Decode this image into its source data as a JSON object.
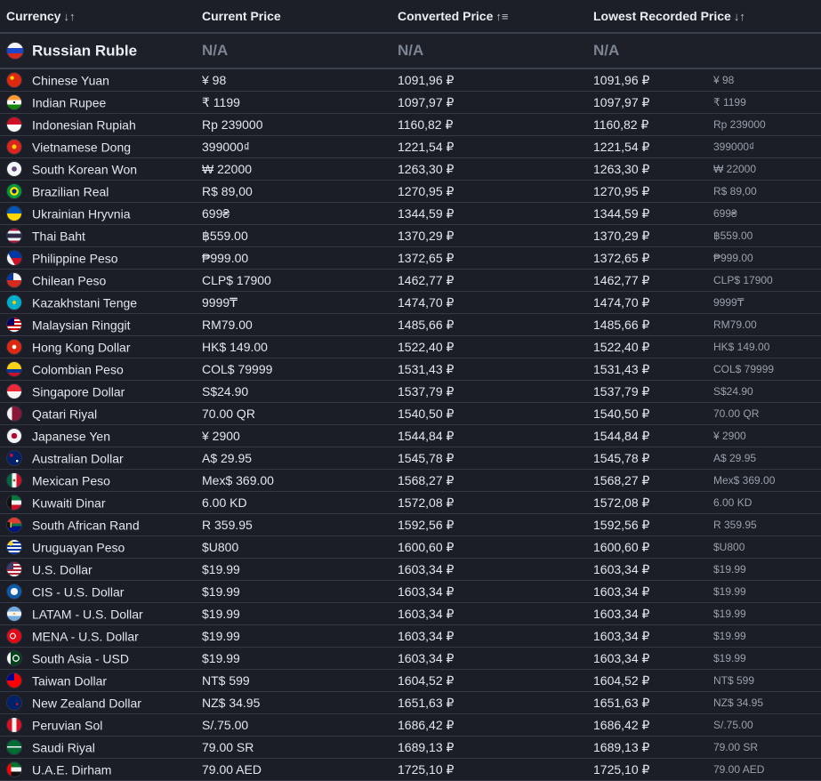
{
  "headers": {
    "currency": "Currency",
    "current_price": "Current Price",
    "converted_price": "Converted Price",
    "lowest_recorded_price": "Lowest Recorded Price",
    "sort_icon_currency": "↓↑",
    "sort_icon_converted": "↑≡",
    "sort_icon_lowest": "↓↑"
  },
  "base_row": {
    "currency": "Russian Ruble",
    "current_price": "N/A",
    "converted_price": "N/A",
    "lowest_recorded_price": "N/A",
    "flag": "russia-flag-icon"
  },
  "rows": [
    {
      "currency": "Chinese Yuan",
      "current_price": "¥ 98",
      "converted_price": "1091,96 ₽",
      "lowest_recorded_price": "1091,96 ₽",
      "lowest_original": "¥ 98",
      "flag": "china-flag-icon"
    },
    {
      "currency": "Indian Rupee",
      "current_price": "₹ 1199",
      "converted_price": "1097,97 ₽",
      "lowest_recorded_price": "1097,97 ₽",
      "lowest_original": "₹ 1199",
      "flag": "india-flag-icon"
    },
    {
      "currency": "Indonesian Rupiah",
      "current_price": "Rp 239000",
      "converted_price": "1160,82 ₽",
      "lowest_recorded_price": "1160,82 ₽",
      "lowest_original": "Rp 239000",
      "flag": "indonesia-flag-icon"
    },
    {
      "currency": "Vietnamese Dong",
      "current_price": "399000₫",
      "converted_price": "1221,54 ₽",
      "lowest_recorded_price": "1221,54 ₽",
      "lowest_original": "399000₫",
      "flag": "vietnam-flag-icon"
    },
    {
      "currency": "South Korean Won",
      "current_price": "₩ 22000",
      "converted_price": "1263,30 ₽",
      "lowest_recorded_price": "1263,30 ₽",
      "lowest_original": "₩ 22000",
      "flag": "south-korea-flag-icon"
    },
    {
      "currency": "Brazilian Real",
      "current_price": "R$ 89,00",
      "converted_price": "1270,95 ₽",
      "lowest_recorded_price": "1270,95 ₽",
      "lowest_original": "R$ 89,00",
      "flag": "brazil-flag-icon"
    },
    {
      "currency": "Ukrainian Hryvnia",
      "current_price": "699₴",
      "converted_price": "1344,59 ₽",
      "lowest_recorded_price": "1344,59 ₽",
      "lowest_original": "699₴",
      "flag": "ukraine-flag-icon"
    },
    {
      "currency": "Thai Baht",
      "current_price": "฿559.00",
      "converted_price": "1370,29 ₽",
      "lowest_recorded_price": "1370,29 ₽",
      "lowest_original": "฿559.00",
      "flag": "thailand-flag-icon"
    },
    {
      "currency": "Philippine Peso",
      "current_price": "₱999.00",
      "converted_price": "1372,65 ₽",
      "lowest_recorded_price": "1372,65 ₽",
      "lowest_original": "₱999.00",
      "flag": "philippines-flag-icon"
    },
    {
      "currency": "Chilean Peso",
      "current_price": "CLP$ 17900",
      "converted_price": "1462,77 ₽",
      "lowest_recorded_price": "1462,77 ₽",
      "lowest_original": "CLP$ 17900",
      "flag": "chile-flag-icon"
    },
    {
      "currency": "Kazakhstani Tenge",
      "current_price": "9999₸",
      "converted_price": "1474,70 ₽",
      "lowest_recorded_price": "1474,70 ₽",
      "lowest_original": "9999₸",
      "flag": "kazakhstan-flag-icon"
    },
    {
      "currency": "Malaysian Ringgit",
      "current_price": "RM79.00",
      "converted_price": "1485,66 ₽",
      "lowest_recorded_price": "1485,66 ₽",
      "lowest_original": "RM79.00",
      "flag": "malaysia-flag-icon"
    },
    {
      "currency": "Hong Kong Dollar",
      "current_price": "HK$ 149.00",
      "converted_price": "1522,40 ₽",
      "lowest_recorded_price": "1522,40 ₽",
      "lowest_original": "HK$ 149.00",
      "flag": "hong-kong-flag-icon"
    },
    {
      "currency": "Colombian Peso",
      "current_price": "COL$ 79999",
      "converted_price": "1531,43 ₽",
      "lowest_recorded_price": "1531,43 ₽",
      "lowest_original": "COL$ 79999",
      "flag": "colombia-flag-icon"
    },
    {
      "currency": "Singapore Dollar",
      "current_price": "S$24.90",
      "converted_price": "1537,79 ₽",
      "lowest_recorded_price": "1537,79 ₽",
      "lowest_original": "S$24.90",
      "flag": "singapore-flag-icon"
    },
    {
      "currency": "Qatari Riyal",
      "current_price": "70.00 QR",
      "converted_price": "1540,50 ₽",
      "lowest_recorded_price": "1540,50 ₽",
      "lowest_original": "70.00 QR",
      "flag": "qatar-flag-icon"
    },
    {
      "currency": "Japanese Yen",
      "current_price": "¥ 2900",
      "converted_price": "1544,84 ₽",
      "lowest_recorded_price": "1544,84 ₽",
      "lowest_original": "¥ 2900",
      "flag": "japan-flag-icon"
    },
    {
      "currency": "Australian Dollar",
      "current_price": "A$ 29.95",
      "converted_price": "1545,78 ₽",
      "lowest_recorded_price": "1545,78 ₽",
      "lowest_original": "A$ 29.95",
      "flag": "australia-flag-icon"
    },
    {
      "currency": "Mexican Peso",
      "current_price": "Mex$ 369.00",
      "converted_price": "1568,27 ₽",
      "lowest_recorded_price": "1568,27 ₽",
      "lowest_original": "Mex$ 369.00",
      "flag": "mexico-flag-icon"
    },
    {
      "currency": "Kuwaiti Dinar",
      "current_price": "6.00 KD",
      "converted_price": "1572,08 ₽",
      "lowest_recorded_price": "1572,08 ₽",
      "lowest_original": "6.00 KD",
      "flag": "kuwait-flag-icon"
    },
    {
      "currency": "South African Rand",
      "current_price": "R 359.95",
      "converted_price": "1592,56 ₽",
      "lowest_recorded_price": "1592,56 ₽",
      "lowest_original": "R 359.95",
      "flag": "south-africa-flag-icon"
    },
    {
      "currency": "Uruguayan Peso",
      "current_price": "$U800",
      "converted_price": "1600,60 ₽",
      "lowest_recorded_price": "1600,60 ₽",
      "lowest_original": "$U800",
      "flag": "uruguay-flag-icon"
    },
    {
      "currency": "U.S. Dollar",
      "current_price": "$19.99",
      "converted_price": "1603,34 ₽",
      "lowest_recorded_price": "1603,34 ₽",
      "lowest_original": "$19.99",
      "flag": "usa-flag-icon"
    },
    {
      "currency": "CIS - U.S. Dollar",
      "current_price": "$19.99",
      "converted_price": "1603,34 ₽",
      "lowest_recorded_price": "1603,34 ₽",
      "lowest_original": "$19.99",
      "flag": "cis-flag-icon"
    },
    {
      "currency": "LATAM - U.S. Dollar",
      "current_price": "$19.99",
      "converted_price": "1603,34 ₽",
      "lowest_recorded_price": "1603,34 ₽",
      "lowest_original": "$19.99",
      "flag": "argentina-flag-icon"
    },
    {
      "currency": "MENA - U.S. Dollar",
      "current_price": "$19.99",
      "converted_price": "1603,34 ₽",
      "lowest_recorded_price": "1603,34 ₽",
      "lowest_original": "$19.99",
      "flag": "turkey-flag-icon"
    },
    {
      "currency": "South Asia - USD",
      "current_price": "$19.99",
      "converted_price": "1603,34 ₽",
      "lowest_recorded_price": "1603,34 ₽",
      "lowest_original": "$19.99",
      "flag": "pakistan-flag-icon"
    },
    {
      "currency": "Taiwan Dollar",
      "current_price": "NT$ 599",
      "converted_price": "1604,52 ₽",
      "lowest_recorded_price": "1604,52 ₽",
      "lowest_original": "NT$ 599",
      "flag": "taiwan-flag-icon"
    },
    {
      "currency": "New Zealand Dollar",
      "current_price": "NZ$ 34.95",
      "converted_price": "1651,63 ₽",
      "lowest_recorded_price": "1651,63 ₽",
      "lowest_original": "NZ$ 34.95",
      "flag": "new-zealand-flag-icon"
    },
    {
      "currency": "Peruvian Sol",
      "current_price": "S/.75.00",
      "converted_price": "1686,42 ₽",
      "lowest_recorded_price": "1686,42 ₽",
      "lowest_original": "S/.75.00",
      "flag": "peru-flag-icon"
    },
    {
      "currency": "Saudi Riyal",
      "current_price": "79.00 SR",
      "converted_price": "1689,13 ₽",
      "lowest_recorded_price": "1689,13 ₽",
      "lowest_original": "79.00 SR",
      "flag": "saudi-arabia-flag-icon"
    },
    {
      "currency": "U.A.E. Dirham",
      "current_price": "79.00 AED",
      "converted_price": "1725,10 ₽",
      "lowest_recorded_price": "1725,10 ₽",
      "lowest_original": "79.00 AED",
      "flag": "uae-flag-icon"
    }
  ],
  "colors": {
    "background": "#1b1e27",
    "row_divider": "#333844",
    "text": "#e3e6ec",
    "muted_text": "#9aa0ab",
    "na_text": "#7d8492"
  }
}
